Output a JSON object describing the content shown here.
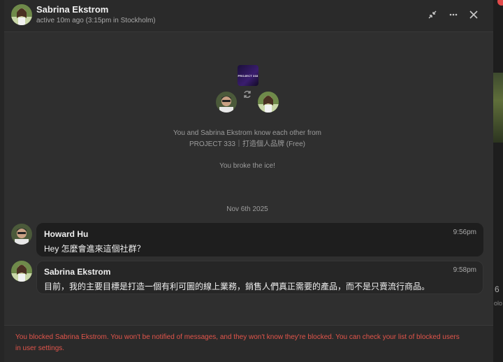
{
  "header": {
    "name": "Sabrina Ekstrom",
    "status": "active 10m ago (3:15pm in Stockholm)"
  },
  "intro": {
    "project_logo_text": "PROJECT 333",
    "line1": "You and Sabrina Ekstrom know each other from",
    "line2": "PROJECT 333｜打造個人品牌 (Free)",
    "ice": "You broke the ice!"
  },
  "date_separator": "Nov 6th 2025",
  "messages": [
    {
      "sender": "Howard Hu",
      "time": "9:56pm",
      "text": "Hey 怎麼會進來這個社群？"
    },
    {
      "sender": "Sabrina Ekstrom",
      "time": "9:58pm",
      "text": "目前，我的主要目標是打造一個有利可圖的線上業務，銷售人們真正需要的產品，而不是只賣流行商品。"
    }
  ],
  "blocked_notice": {
    "line1": "You blocked Sabrina Ekstrom. You won't be notified of messages, and they won't know they're blocked. You can check your list of blocked users",
    "line2": "in user settings."
  },
  "background_fragments": {
    "right_char": "6",
    "right_small": "olo"
  },
  "colors": {
    "accent_red": "#e2554b",
    "panel": "#2f2f2f",
    "bubble_dark": "#1e1e1e"
  },
  "icons": [
    "minimize-icon",
    "more-icon",
    "close-icon",
    "swap-icon"
  ]
}
